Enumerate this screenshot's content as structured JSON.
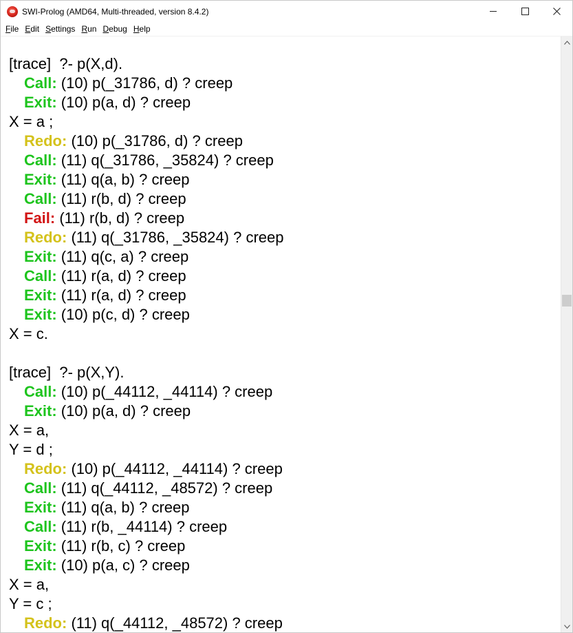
{
  "window": {
    "title": "SWI-Prolog (AMD64, Multi-threaded, version 8.4.2)",
    "icon": "swi-prolog-owl-icon"
  },
  "window_controls": {
    "minimize": "minimize-icon",
    "maximize": "maximize-icon",
    "close": "close-icon"
  },
  "menu": {
    "items": [
      {
        "label": "File",
        "underline": "F",
        "rest": "ile"
      },
      {
        "label": "Edit",
        "underline": "E",
        "rest": "dit"
      },
      {
        "label": "Settings",
        "underline": "S",
        "rest": "ettings"
      },
      {
        "label": "Run",
        "underline": "R",
        "rest": "un"
      },
      {
        "label": "Debug",
        "underline": "D",
        "rest": "ebug"
      },
      {
        "label": "Help",
        "underline": "H",
        "rest": "elp"
      }
    ]
  },
  "colors": {
    "call_exit": "#1ec41e",
    "redo": "#d4c21b",
    "fail": "#d21414"
  },
  "console": {
    "lines": [
      {
        "type": "plain",
        "text": "[trace]  ?- p(X,d)."
      },
      {
        "type": "port",
        "port": "Call:",
        "kind": "call",
        "text": " (10) p(_31786, d) ? creep"
      },
      {
        "type": "port",
        "port": "Exit:",
        "kind": "exit",
        "text": " (10) p(a, d) ? creep"
      },
      {
        "type": "plain",
        "text": "X = a ;"
      },
      {
        "type": "port",
        "port": "Redo:",
        "kind": "redo",
        "text": " (10) p(_31786, d) ? creep"
      },
      {
        "type": "port",
        "port": "Call:",
        "kind": "call",
        "text": " (11) q(_31786, _35824) ? creep"
      },
      {
        "type": "port",
        "port": "Exit:",
        "kind": "exit",
        "text": " (11) q(a, b) ? creep"
      },
      {
        "type": "port",
        "port": "Call:",
        "kind": "call",
        "text": " (11) r(b, d) ? creep"
      },
      {
        "type": "port",
        "port": "Fail:",
        "kind": "fail",
        "text": " (11) r(b, d) ? creep"
      },
      {
        "type": "port",
        "port": "Redo:",
        "kind": "redo",
        "text": " (11) q(_31786, _35824) ? creep"
      },
      {
        "type": "port",
        "port": "Exit:",
        "kind": "exit",
        "text": " (11) q(c, a) ? creep"
      },
      {
        "type": "port",
        "port": "Call:",
        "kind": "call",
        "text": " (11) r(a, d) ? creep"
      },
      {
        "type": "port",
        "port": "Exit:",
        "kind": "exit",
        "text": " (11) r(a, d) ? creep"
      },
      {
        "type": "port",
        "port": "Exit:",
        "kind": "exit",
        "text": " (10) p(c, d) ? creep"
      },
      {
        "type": "plain",
        "text": "X = c."
      },
      {
        "type": "plain",
        "text": ""
      },
      {
        "type": "plain",
        "text": "[trace]  ?- p(X,Y)."
      },
      {
        "type": "port",
        "port": "Call:",
        "kind": "call",
        "text": " (10) p(_44112, _44114) ? creep"
      },
      {
        "type": "port",
        "port": "Exit:",
        "kind": "exit",
        "text": " (10) p(a, d) ? creep"
      },
      {
        "type": "plain",
        "text": "X = a,"
      },
      {
        "type": "plain",
        "text": "Y = d ;"
      },
      {
        "type": "port",
        "port": "Redo:",
        "kind": "redo",
        "text": " (10) p(_44112, _44114) ? creep"
      },
      {
        "type": "port",
        "port": "Call:",
        "kind": "call",
        "text": " (11) q(_44112, _48572) ? creep"
      },
      {
        "type": "port",
        "port": "Exit:",
        "kind": "exit",
        "text": " (11) q(a, b) ? creep"
      },
      {
        "type": "port",
        "port": "Call:",
        "kind": "call",
        "text": " (11) r(b, _44114) ? creep"
      },
      {
        "type": "port",
        "port": "Exit:",
        "kind": "exit",
        "text": " (11) r(b, c) ? creep"
      },
      {
        "type": "port",
        "port": "Exit:",
        "kind": "exit",
        "text": " (10) p(a, c) ? creep"
      },
      {
        "type": "plain",
        "text": "X = a,"
      },
      {
        "type": "plain",
        "text": "Y = c ;"
      },
      {
        "type": "port",
        "port": "Redo:",
        "kind": "redo",
        "text": " (11) q(_44112, _48572) ? creep"
      }
    ]
  },
  "scrollbar": {
    "up_icon": "scroll-up-arrow-icon",
    "down_icon": "scroll-down-arrow-icon"
  }
}
